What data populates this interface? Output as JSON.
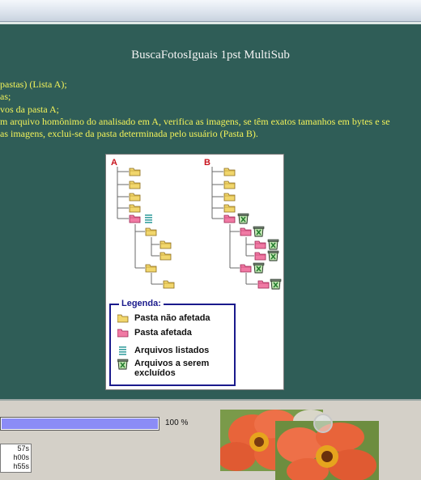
{
  "app": {
    "title": "BuscaFotosIguais 1pst MultiSub"
  },
  "description": {
    "lines": [
      "pastas) (Lista A);",
      "as;",
      "vos da pasta A;",
      "m arquivo homônimo do analisado em A, verifica as imagens, se têm exatos tamanhos em bytes e se",
      "as imagens, exclui-se da pasta determinada pelo usuário (Pasta B)."
    ]
  },
  "diagram": {
    "label_a": "A",
    "label_b": "B",
    "legend": {
      "title": "Legenda:",
      "folder_unaffected": "Pasta não afetada",
      "folder_affected": "Pasta afetada",
      "files_listed": "Arquivos listados",
      "files_to_delete_line1": "Arquivos a serem",
      "files_to_delete_line2": "excluídos"
    }
  },
  "progress": {
    "value": 1.0,
    "label": "100 %"
  },
  "times": {
    "lines": [
      "57s",
      "h00s",
      "h55s"
    ]
  },
  "colors": {
    "background": "#2f5d57",
    "title_text": "#f2f2f2",
    "description_text": "#f2f25a",
    "progress_fill": "#8b8cf6",
    "legend_border": "#1a1a8c",
    "tree_label": "#c8141e"
  }
}
